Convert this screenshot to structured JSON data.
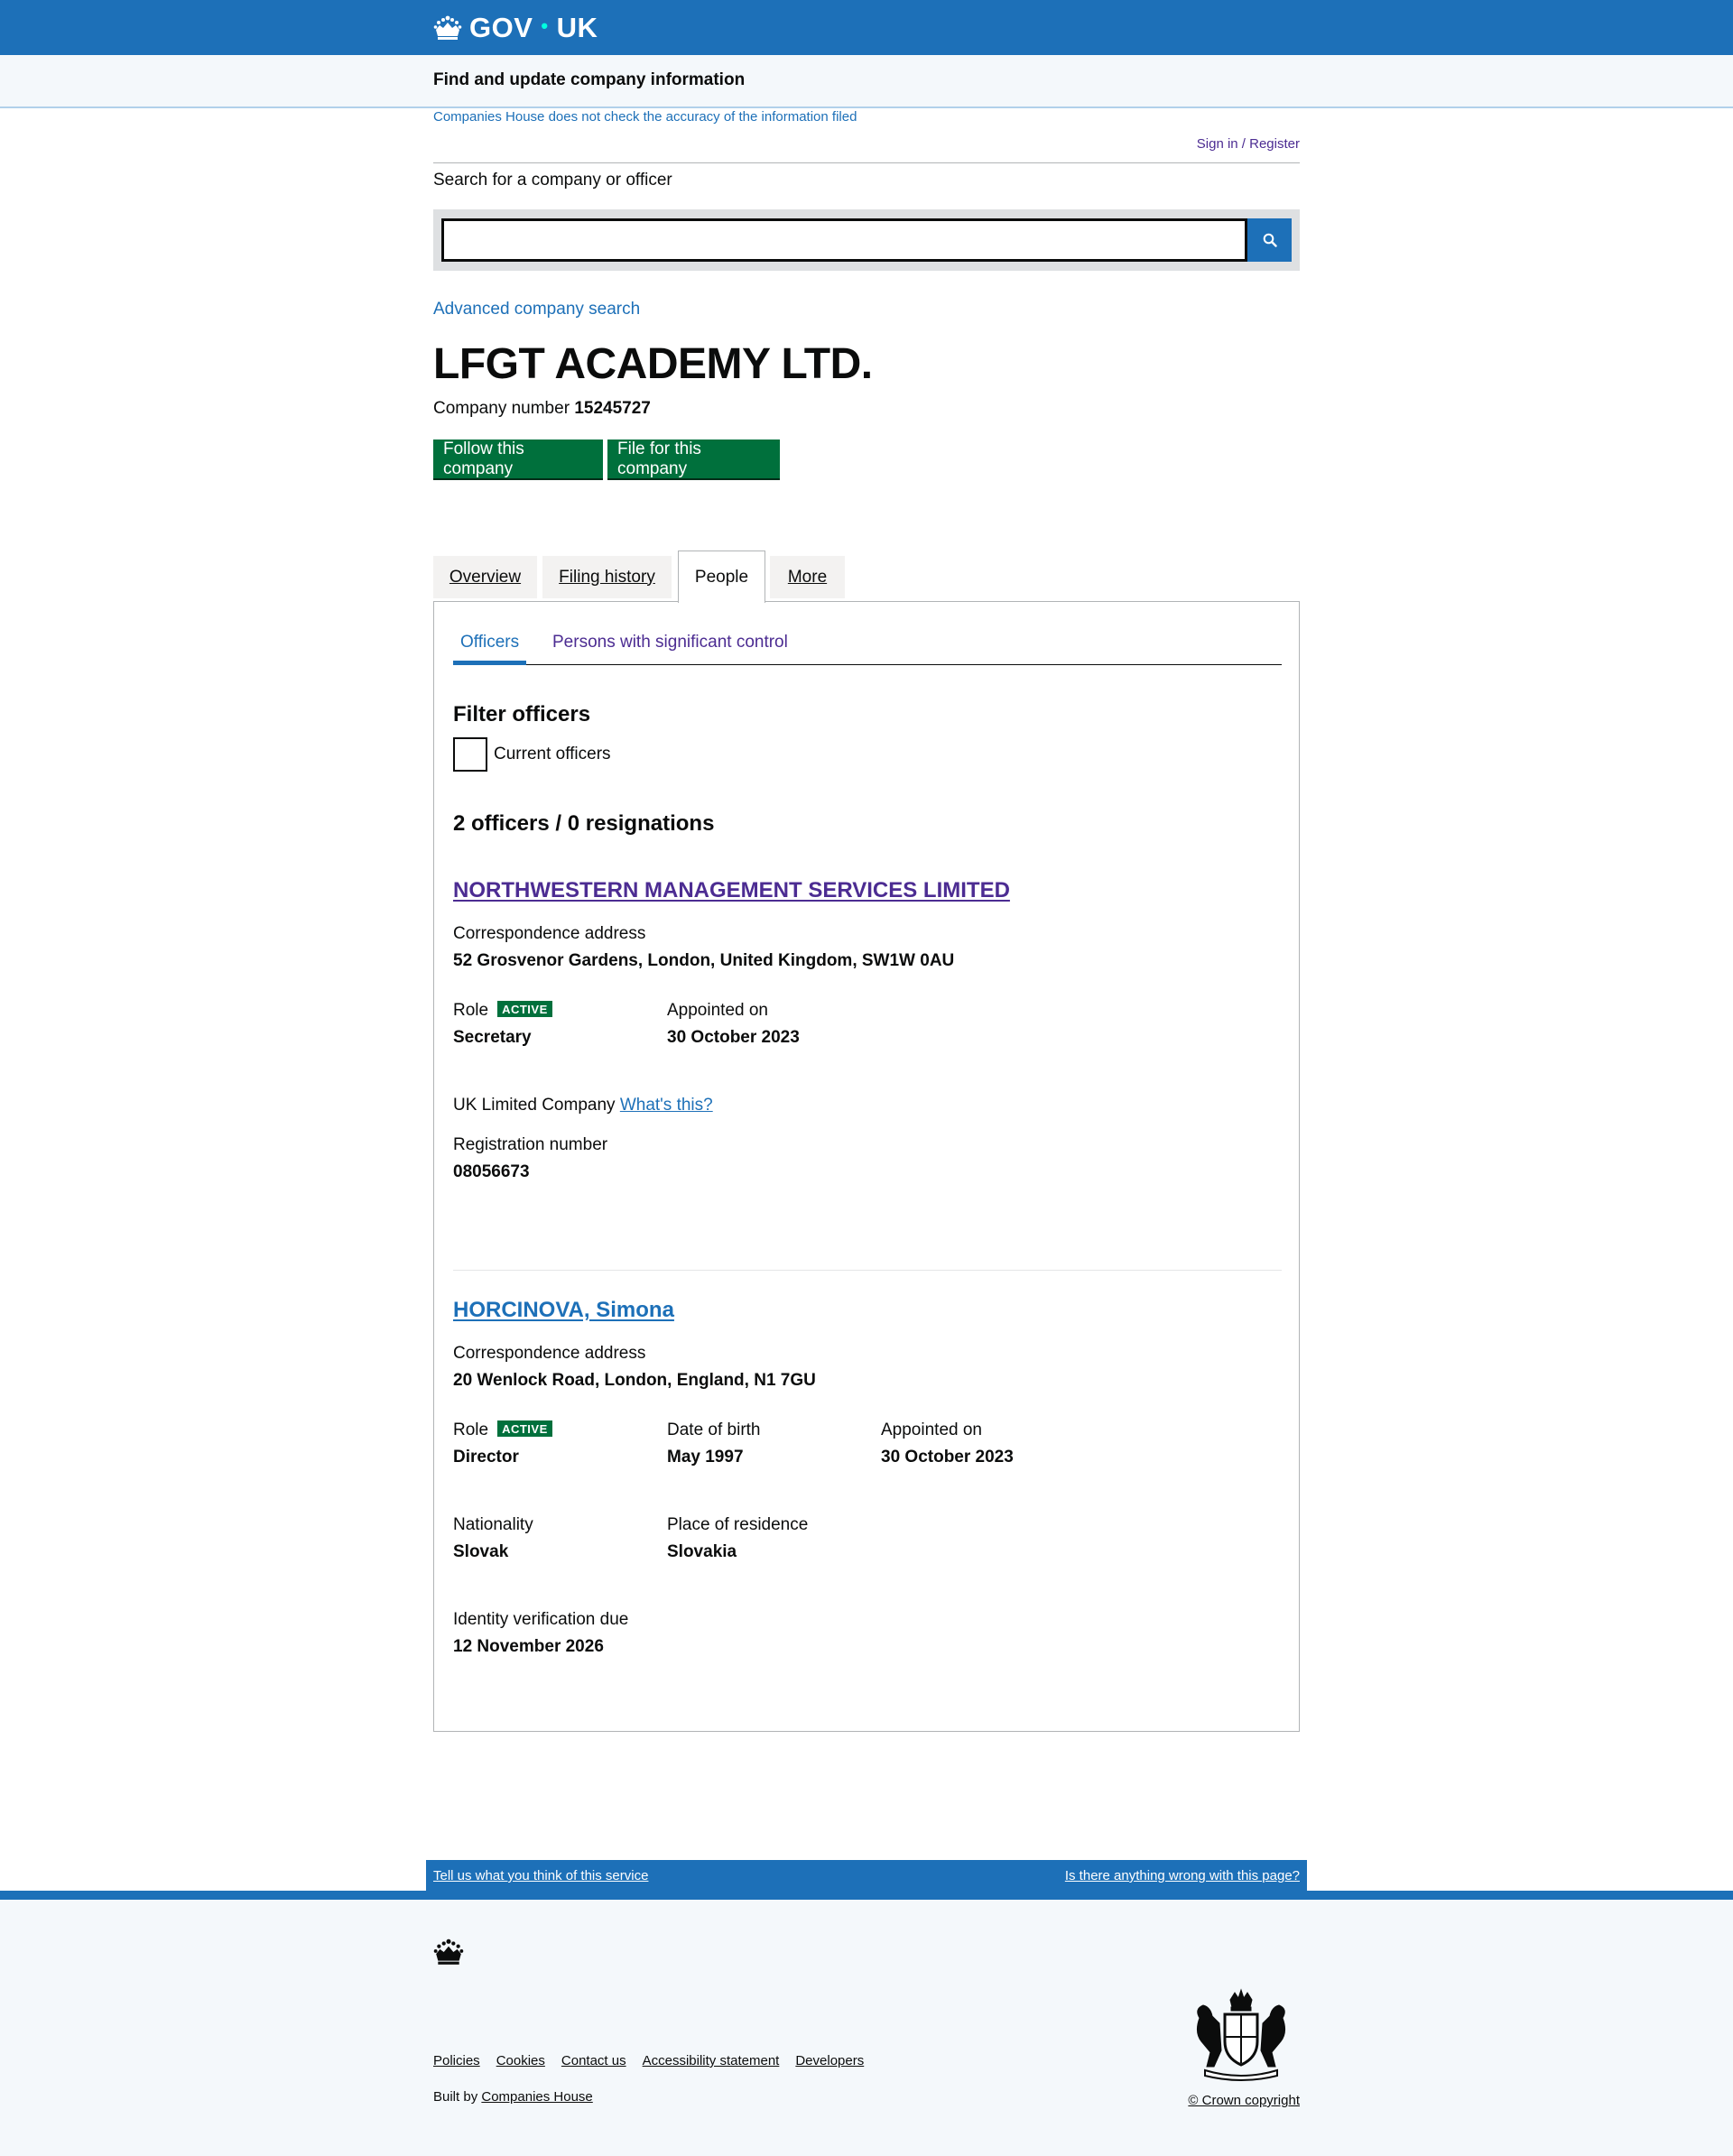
{
  "header": {
    "logo_text_left": "GOV",
    "logo_dot": "•",
    "logo_text_right": "UK",
    "service_name": "Find and update company information"
  },
  "notices": {
    "accuracy_link": "Companies House does not check the accuracy of the information filed",
    "signin_link": "Sign in / Register"
  },
  "search": {
    "label": "Search for a company or officer",
    "placeholder": "",
    "value": "",
    "button_icon": "search-icon",
    "advanced_link": "Advanced company search"
  },
  "company": {
    "name": "LFGT ACADEMY LTD.",
    "number_label": "Company number",
    "number": "15245727",
    "follow_button": "Follow this company",
    "file_button": "File for this company"
  },
  "tabs": [
    {
      "label": "Overview"
    },
    {
      "label": "Filing history"
    },
    {
      "label": "People",
      "active": true
    },
    {
      "label": "More"
    }
  ],
  "subnav": {
    "officers": "Officers",
    "psc": "Persons with significant control"
  },
  "filter": {
    "title": "Filter officers",
    "checkbox_label": "Current officers",
    "checked": false
  },
  "summary": "2 officers / 0 resignations",
  "officers": [
    {
      "name": "NORTHWESTERN MANAGEMENT SERVICES LIMITED",
      "address_label": "Correspondence address",
      "address": "52 Grosvenor Gardens, London, United Kingdom, SW1W 0AU",
      "role_label": "Role",
      "status": "ACTIVE",
      "role": "Secretary",
      "appointed_label": "Appointed on",
      "appointed": "30 October 2023",
      "company_type": "UK Limited Company",
      "whats_this": "What's this?",
      "reg_label": "Registration number",
      "reg_number": "08056673"
    },
    {
      "name": "HORCINOVA, Simona",
      "address_label": "Correspondence address",
      "address": "20 Wenlock Road, London, England, N1 7GU",
      "role_label": "Role",
      "status": "ACTIVE",
      "role": "Director",
      "dob_label": "Date of birth",
      "dob": "May 1997",
      "appointed_label": "Appointed on",
      "appointed": "30 October 2023",
      "nationality_label": "Nationality",
      "nationality": "Slovak",
      "residence_label": "Place of residence",
      "residence": "Slovakia",
      "idv_label": "Identity verification due",
      "idv": "12 November 2026"
    }
  ],
  "footer": {
    "feedback_left": "Tell us what you think of this service",
    "feedback_right": "Is there anything wrong with this page?",
    "links": [
      "Policies",
      "Cookies",
      "Contact us",
      "Accessibility statement",
      "Developers"
    ],
    "built_by_prefix": "Built by",
    "built_by_link": "Companies House",
    "crown_copyright": "© Crown copyright"
  },
  "colors": {
    "brand_blue": "#1d70b8",
    "button_green": "#00703c",
    "visited_purple": "#4c2c92",
    "logo_dot": "#00ffe0"
  }
}
